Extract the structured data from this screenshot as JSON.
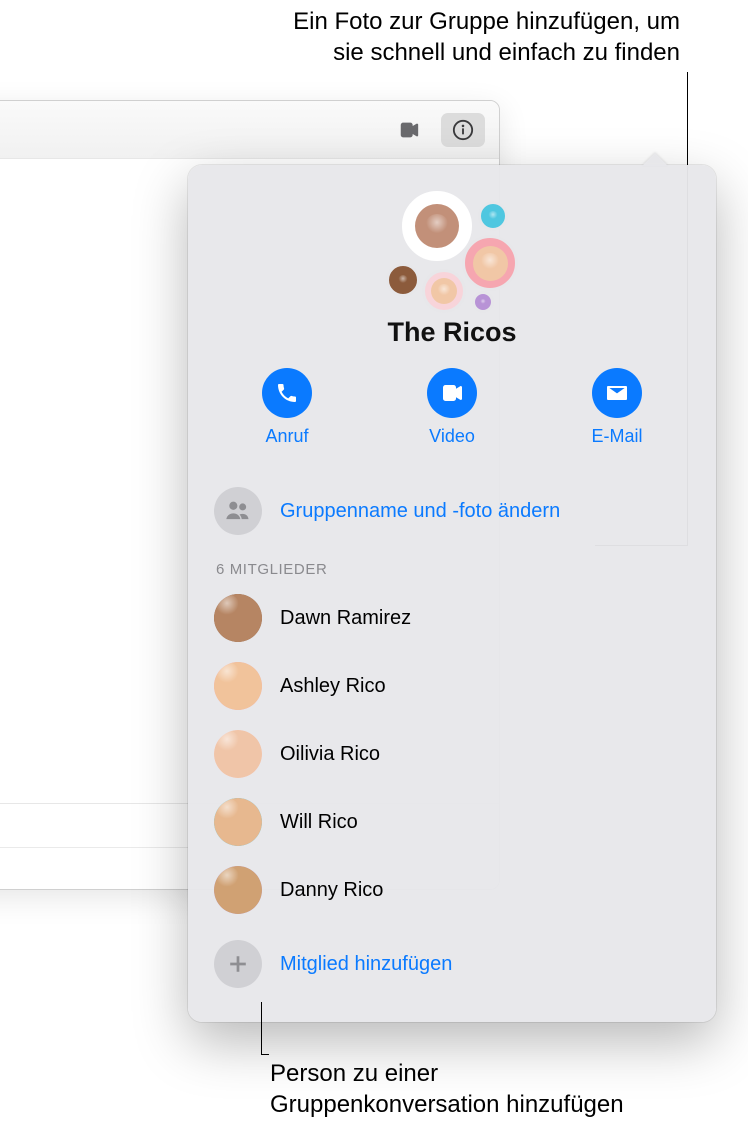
{
  "callouts": {
    "top": "Ein Foto zur Gruppe hinzufügen, um\nsie schnell und einfach zu finden",
    "bottom": "Person zu einer\nGruppenkonversation hinzufügen"
  },
  "toolbar": {
    "video_icon": "video-icon",
    "info_icon": "info-icon"
  },
  "group": {
    "name": "The Ricos"
  },
  "actions": {
    "call": "Anruf",
    "video": "Video",
    "mail": "E-Mail"
  },
  "edit_group_label": "Gruppenname und -foto ändern",
  "members_header": "6 MITGLIEDER",
  "members": [
    {
      "name": "Dawn Ramirez"
    },
    {
      "name": "Ashley Rico"
    },
    {
      "name": "Oilivia Rico"
    },
    {
      "name": "Will Rico"
    },
    {
      "name": "Danny Rico"
    }
  ],
  "add_member_label": "Mitglied hinzufügen"
}
